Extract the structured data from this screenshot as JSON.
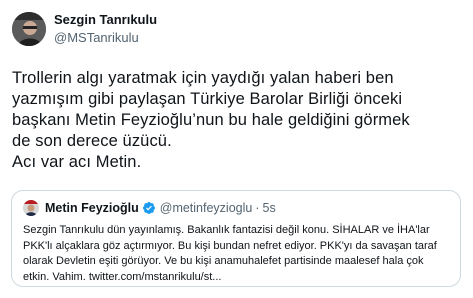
{
  "tweet": {
    "author": {
      "display_name": "Sezgin Tanrıkulu",
      "handle": "@MSTanrikulu"
    },
    "text": "Trollerin algı yaratmak için yaydığı yalan haberi ben\nyazmışım gibi paylaşan Türkiye Barolar Birliği önceki\nbaşkanı Metin Feyzioğlu’nun bu hale geldiğini görmek\nde son derece üzücü.\nAcı var acı Metin.",
    "quoted_tweet": {
      "author": {
        "display_name": "Metin Feyzioğlu",
        "handle": "@metinfeyzioglu",
        "verified": true
      },
      "separator": "·",
      "time": "5s",
      "text": "Sezgin Tanrıkulu dün yayınlamış. Bakanlık fantazisi değil konu. SİHALAR ve İHA'lar PKK'lı alçaklara göz açtırmıyor. Bu kişi bundan nefret ediyor. PKK'yı da savaşan taraf olarak Devletin eşiti görüyor. Ve bu kişi anamuhalefet partisinde maalesef hala çok etkin. Vahim. twitter.com/mstanrikulu/st..."
    }
  },
  "colors": {
    "text_primary": "#0f1419",
    "text_secondary": "#536471",
    "border": "#cfd9de",
    "verified_badge": "#1d9bf0"
  },
  "icons": {
    "verified": "verified-badge-icon"
  }
}
